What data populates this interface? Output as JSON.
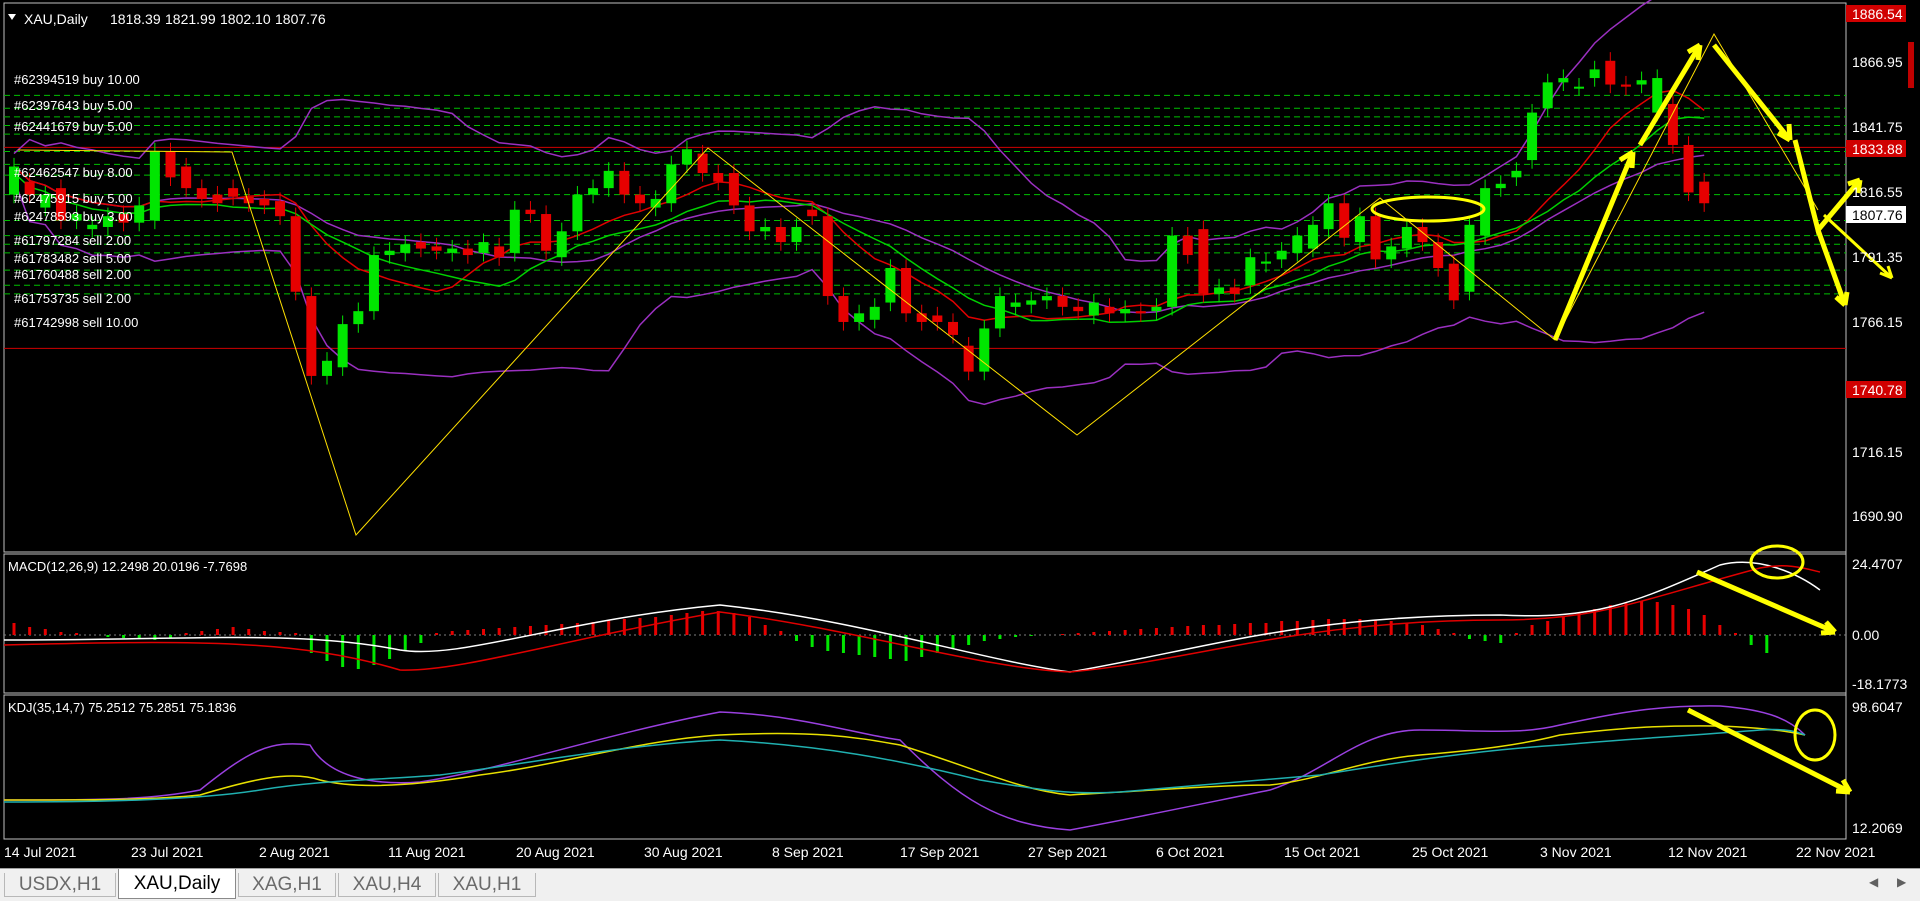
{
  "header": {
    "symbol": "XAU,Daily",
    "open": "1818.39",
    "high": "1821.99",
    "low": "1802.10",
    "close": "1807.76"
  },
  "price_axis": [
    "1886.54",
    "1866.95",
    "1841.75",
    "1833.88",
    "1816.55",
    "1807.76",
    "1791.35",
    "1766.15",
    "1740.78",
    "1716.15",
    "1690.90"
  ],
  "price_tags": {
    "top": "1886.54",
    "resistance": "1833.88",
    "current": "1807.76",
    "support": "1740.78"
  },
  "orders": [
    "#62394519 buy 10.00",
    "#62397643 buy 5.00",
    "#62441679 buy 5.00",
    "#62462547 buy 8.00",
    "#62475915 buy 5.00",
    "#62478593 buy 3.00",
    "#61797284 sell 2.00",
    "#61783482 sell 5.00",
    "#61760488 sell 2.00",
    "#61753735 sell 2.00",
    "#61742998 sell 10.00"
  ],
  "macd": {
    "label": "MACD(12,26,9) 12.2498 20.0196 -7.7698",
    "axis": [
      "24.4707",
      "0.00",
      "-18.1773"
    ]
  },
  "kdj": {
    "label": "KDJ(35,14,7) 75.2512 75.2851 75.1836",
    "axis": [
      "98.6047",
      "12.2069"
    ]
  },
  "dates": [
    "14 Jul 2021",
    "23 Jul 2021",
    "2 Aug 2021",
    "11 Aug 2021",
    "20 Aug 2021",
    "30 Aug 2021",
    "8 Sep 2021",
    "17 Sep 2021",
    "27 Sep 2021",
    "6 Oct 2021",
    "15 Oct 2021",
    "25 Oct 2021",
    "3 Nov 2021",
    "12 Nov 2021",
    "22 Nov 2021"
  ],
  "tabs": [
    "USDX,H1",
    "XAU,Daily",
    "XAG,H1",
    "XAU,H4",
    "XAU,H1"
  ],
  "active_tab": "XAU,Daily",
  "colors": {
    "background": "#000000",
    "bull": "#00e600",
    "bear": "#e60000",
    "bollinger": "#9a30c0",
    "ma_fast": "#e00000",
    "ma_slow": "#00d000",
    "zigzag": "#ffe000",
    "annotation": "#ffff00",
    "grid": "#00c000",
    "tag_red": "#d00000"
  },
  "chart_data": {
    "type": "candlestick",
    "title": "XAU,Daily",
    "ylim": [
      1675,
      1895
    ],
    "bars": [
      {
        "o": 1812,
        "c": 1825
      },
      {
        "o": 1818,
        "c": 1812
      },
      {
        "o": 1806,
        "c": 1812
      },
      {
        "o": 1815,
        "c": 1800
      },
      {
        "o": 1800,
        "c": 1803
      },
      {
        "o": 1796,
        "c": 1798
      },
      {
        "o": 1797,
        "c": 1802
      },
      {
        "o": 1803,
        "c": 1799
      },
      {
        "o": 1799,
        "c": 1807
      },
      {
        "o": 1800,
        "c": 1832
      },
      {
        "o": 1832,
        "c": 1820
      },
      {
        "o": 1825,
        "c": 1815
      },
      {
        "o": 1815,
        "c": 1810
      },
      {
        "o": 1812,
        "c": 1808
      },
      {
        "o": 1815,
        "c": 1811
      },
      {
        "o": 1811,
        "c": 1808
      },
      {
        "o": 1810,
        "c": 1807
      },
      {
        "o": 1809,
        "c": 1802
      },
      {
        "o": 1802,
        "c": 1767
      },
      {
        "o": 1765,
        "c": 1728
      },
      {
        "o": 1728,
        "c": 1735
      },
      {
        "o": 1732,
        "c": 1752
      },
      {
        "o": 1752,
        "c": 1758
      },
      {
        "o": 1758,
        "c": 1784
      },
      {
        "o": 1784,
        "c": 1786
      },
      {
        "o": 1785,
        "c": 1789
      },
      {
        "o": 1790,
        "c": 1787
      },
      {
        "o": 1788,
        "c": 1786
      },
      {
        "o": 1785,
        "c": 1787
      },
      {
        "o": 1787,
        "c": 1784
      },
      {
        "o": 1785,
        "c": 1790
      },
      {
        "o": 1788,
        "c": 1783
      },
      {
        "o": 1785,
        "c": 1805
      },
      {
        "o": 1805,
        "c": 1803
      },
      {
        "o": 1803,
        "c": 1786
      },
      {
        "o": 1783,
        "c": 1795
      },
      {
        "o": 1795,
        "c": 1812
      },
      {
        "o": 1812,
        "c": 1815
      },
      {
        "o": 1815,
        "c": 1823
      },
      {
        "o": 1823,
        "c": 1812
      },
      {
        "o": 1812,
        "c": 1808
      },
      {
        "o": 1806,
        "c": 1810
      },
      {
        "o": 1808,
        "c": 1826
      },
      {
        "o": 1826,
        "c": 1833
      },
      {
        "o": 1831,
        "c": 1822
      },
      {
        "o": 1822,
        "c": 1818
      },
      {
        "o": 1822,
        "c": 1807
      },
      {
        "o": 1807,
        "c": 1795
      },
      {
        "o": 1795,
        "c": 1797
      },
      {
        "o": 1797,
        "c": 1790
      },
      {
        "o": 1790,
        "c": 1797
      },
      {
        "o": 1805,
        "c": 1802
      },
      {
        "o": 1802,
        "c": 1765
      },
      {
        "o": 1765,
        "c": 1753
      },
      {
        "o": 1753,
        "c": 1757
      },
      {
        "o": 1754,
        "c": 1760
      },
      {
        "o": 1762,
        "c": 1778
      },
      {
        "o": 1778,
        "c": 1757
      },
      {
        "o": 1757,
        "c": 1753
      },
      {
        "o": 1756,
        "c": 1753
      },
      {
        "o": 1753,
        "c": 1747
      },
      {
        "o": 1742,
        "c": 1730
      },
      {
        "o": 1730,
        "c": 1750
      },
      {
        "o": 1750,
        "c": 1765
      },
      {
        "o": 1760,
        "c": 1762
      },
      {
        "o": 1761,
        "c": 1763
      },
      {
        "o": 1763,
        "c": 1765
      },
      {
        "o": 1765,
        "c": 1760
      },
      {
        "o": 1760,
        "c": 1758
      },
      {
        "o": 1756,
        "c": 1762
      },
      {
        "o": 1760,
        "c": 1757
      },
      {
        "o": 1757,
        "c": 1759
      },
      {
        "o": 1758,
        "c": 1757
      },
      {
        "o": 1758,
        "c": 1760
      },
      {
        "o": 1760,
        "c": 1793
      },
      {
        "o": 1793,
        "c": 1784
      },
      {
        "o": 1796,
        "c": 1766
      },
      {
        "o": 1766,
        "c": 1769
      },
      {
        "o": 1769,
        "c": 1766
      },
      {
        "o": 1770,
        "c": 1783
      },
      {
        "o": 1780,
        "c": 1781
      },
      {
        "o": 1782,
        "c": 1786
      },
      {
        "o": 1785,
        "c": 1793
      },
      {
        "o": 1787,
        "c": 1798
      },
      {
        "o": 1796,
        "c": 1808
      },
      {
        "o": 1808,
        "c": 1792
      },
      {
        "o": 1790,
        "c": 1802
      },
      {
        "o": 1802,
        "c": 1782
      },
      {
        "o": 1782,
        "c": 1788
      },
      {
        "o": 1787,
        "c": 1797
      },
      {
        "o": 1797,
        "c": 1790
      },
      {
        "o": 1790,
        "c": 1778
      },
      {
        "o": 1780,
        "c": 1763
      },
      {
        "o": 1767,
        "c": 1798
      },
      {
        "o": 1793,
        "c": 1815
      },
      {
        "o": 1815,
        "c": 1817
      },
      {
        "o": 1820,
        "c": 1823
      },
      {
        "o": 1828,
        "c": 1850
      },
      {
        "o": 1852,
        "c": 1864
      },
      {
        "o": 1864,
        "c": 1866
      },
      {
        "o": 1862,
        "c": 1862
      },
      {
        "o": 1866,
        "c": 1870
      },
      {
        "o": 1874,
        "c": 1863
      },
      {
        "o": 1863,
        "c": 1862
      },
      {
        "o": 1863,
        "c": 1865
      },
      {
        "o": 1850,
        "c": 1866
      },
      {
        "o": 1854,
        "c": 1835
      },
      {
        "o": 1835,
        "c": 1813
      },
      {
        "o": 1818,
        "c": 1808
      }
    ],
    "horizontal_lines": {
      "resistance": 1833.88,
      "support": 1740.78
    }
  }
}
